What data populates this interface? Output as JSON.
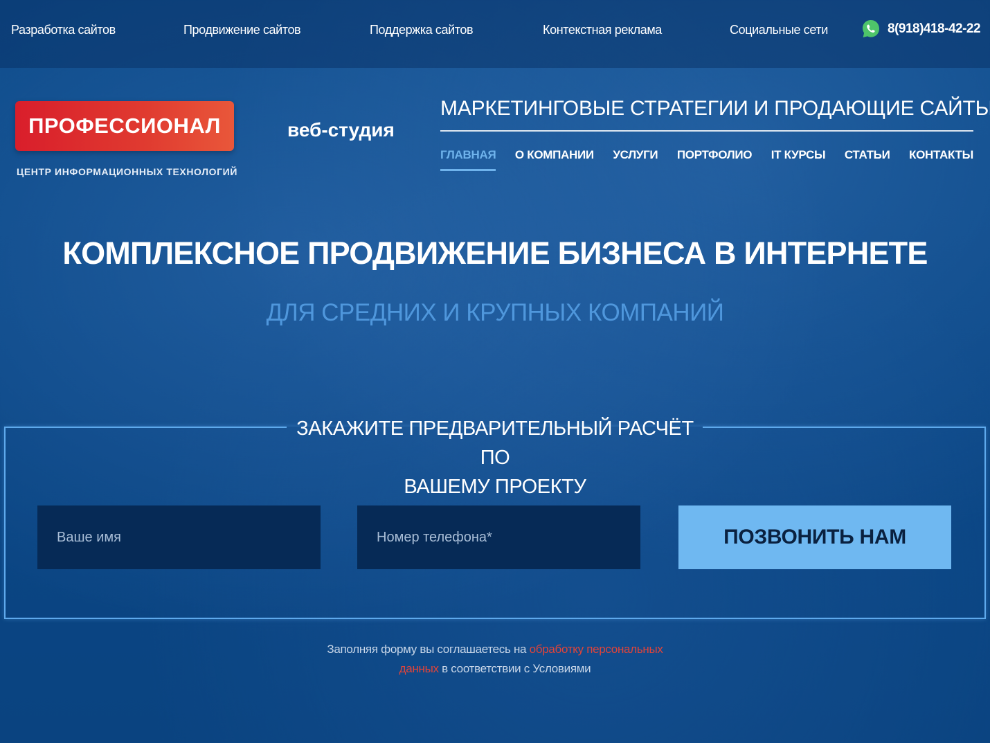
{
  "topbar": {
    "items": [
      "Разработка сайтов",
      "Продвижение сайтов",
      "Поддержка сайтов",
      "Контекстная реклама",
      "Социальные сети"
    ],
    "phone": "8(918)418-42-22",
    "phone_icon": "whatsapp-icon"
  },
  "header": {
    "logo_text": "ПРОФЕССИОНАЛ",
    "logo_subtitle": "ЦЕНТР ИНФОРМАЦИОННЫХ ТЕХНОЛОГИЙ",
    "studio": "веб-студия",
    "tagline": "МАРКЕТИНГОВЫЕ СТРАТЕГИИ И ПРОДАЮЩИЕ САЙТЫ",
    "nav": [
      "ГЛАВНАЯ",
      "О КОМПАНИИ",
      "УСЛУГИ",
      "ПОРТФОЛИО",
      "IT КУРСЫ",
      "СТАТЬИ",
      "КОНТАКТЫ"
    ],
    "nav_active": "ГЛАВНАЯ"
  },
  "hero": {
    "title": "КОМПЛЕКСНОЕ ПРОДВИЖЕНИЕ БИЗНЕСА В ИНТЕРНЕТЕ",
    "subtitle": "ДЛЯ СРЕДНИХ И КРУПНЫХ КОМПАНИЙ"
  },
  "form": {
    "title_line1": "ЗАКАЖИТЕ ПРЕДВАРИТЕЛЬНЫЙ РАСЧЁТ ПО",
    "title_line2": "ВАШЕМУ ПРОЕКТУ",
    "name_placeholder": "Ваше имя",
    "name_value": "",
    "phone_placeholder": "Номер телефона*",
    "phone_value": "",
    "button_label": "ПОЗВОНИТЬ НАМ"
  },
  "consent": {
    "text_before": "Заполняя форму вы соглашаетесь на ",
    "link_text_1": "обработку персональных",
    "link_text_2": "данных",
    "text_after": " в соответствии с Условиями"
  },
  "colors": {
    "background": "#0c4886",
    "accent": "#6fb8f1",
    "logo_red": "#d91e2b",
    "link_red": "#e0443a",
    "subtitle_blue": "#4f97dc"
  }
}
